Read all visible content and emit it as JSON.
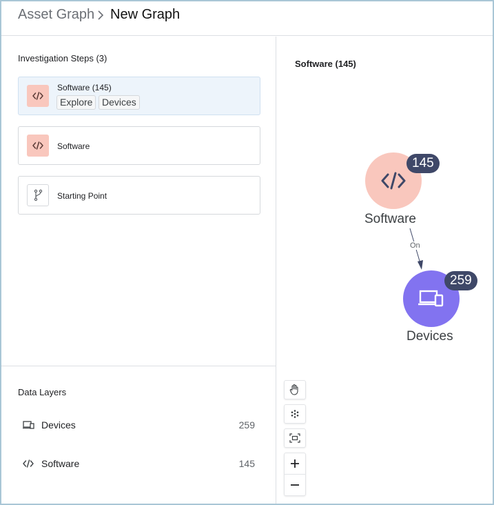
{
  "breadcrumb": {
    "root": "Asset Graph",
    "current": "New Graph"
  },
  "steps": {
    "title": "Investigation Steps (3)",
    "items": [
      {
        "label": "Software (145)",
        "icon": "code-icon",
        "active": true,
        "actions": [
          "Explore",
          "Devices"
        ]
      },
      {
        "label": "Software",
        "icon": "code-icon",
        "active": false
      },
      {
        "label": "Starting Point",
        "icon": "branch-icon",
        "active": false
      }
    ]
  },
  "layers": {
    "title": "Data Layers",
    "items": [
      {
        "name": "Devices",
        "count": "259",
        "icon": "devices-icon"
      },
      {
        "name": "Software",
        "count": "145",
        "icon": "code-icon"
      }
    ]
  },
  "graph": {
    "title": "Software (145)",
    "nodes": [
      {
        "label": "Software",
        "count": "145",
        "color": "#f9c7bd",
        "icon": "code-icon"
      },
      {
        "label": "Devices",
        "count": "259",
        "color": "#8273f0",
        "icon": "devices-icon"
      }
    ],
    "edge_label": "On",
    "tools": [
      "pan-hand-icon",
      "layout-snowflake-icon",
      "fit-screen-icon",
      "zoom-in-icon",
      "zoom-out-icon"
    ]
  },
  "colors": {
    "accent_badge": "#3f4868",
    "software_node": "#f9c7bd",
    "devices_node": "#8273f0",
    "active_step_bg": "#edf4fb"
  }
}
